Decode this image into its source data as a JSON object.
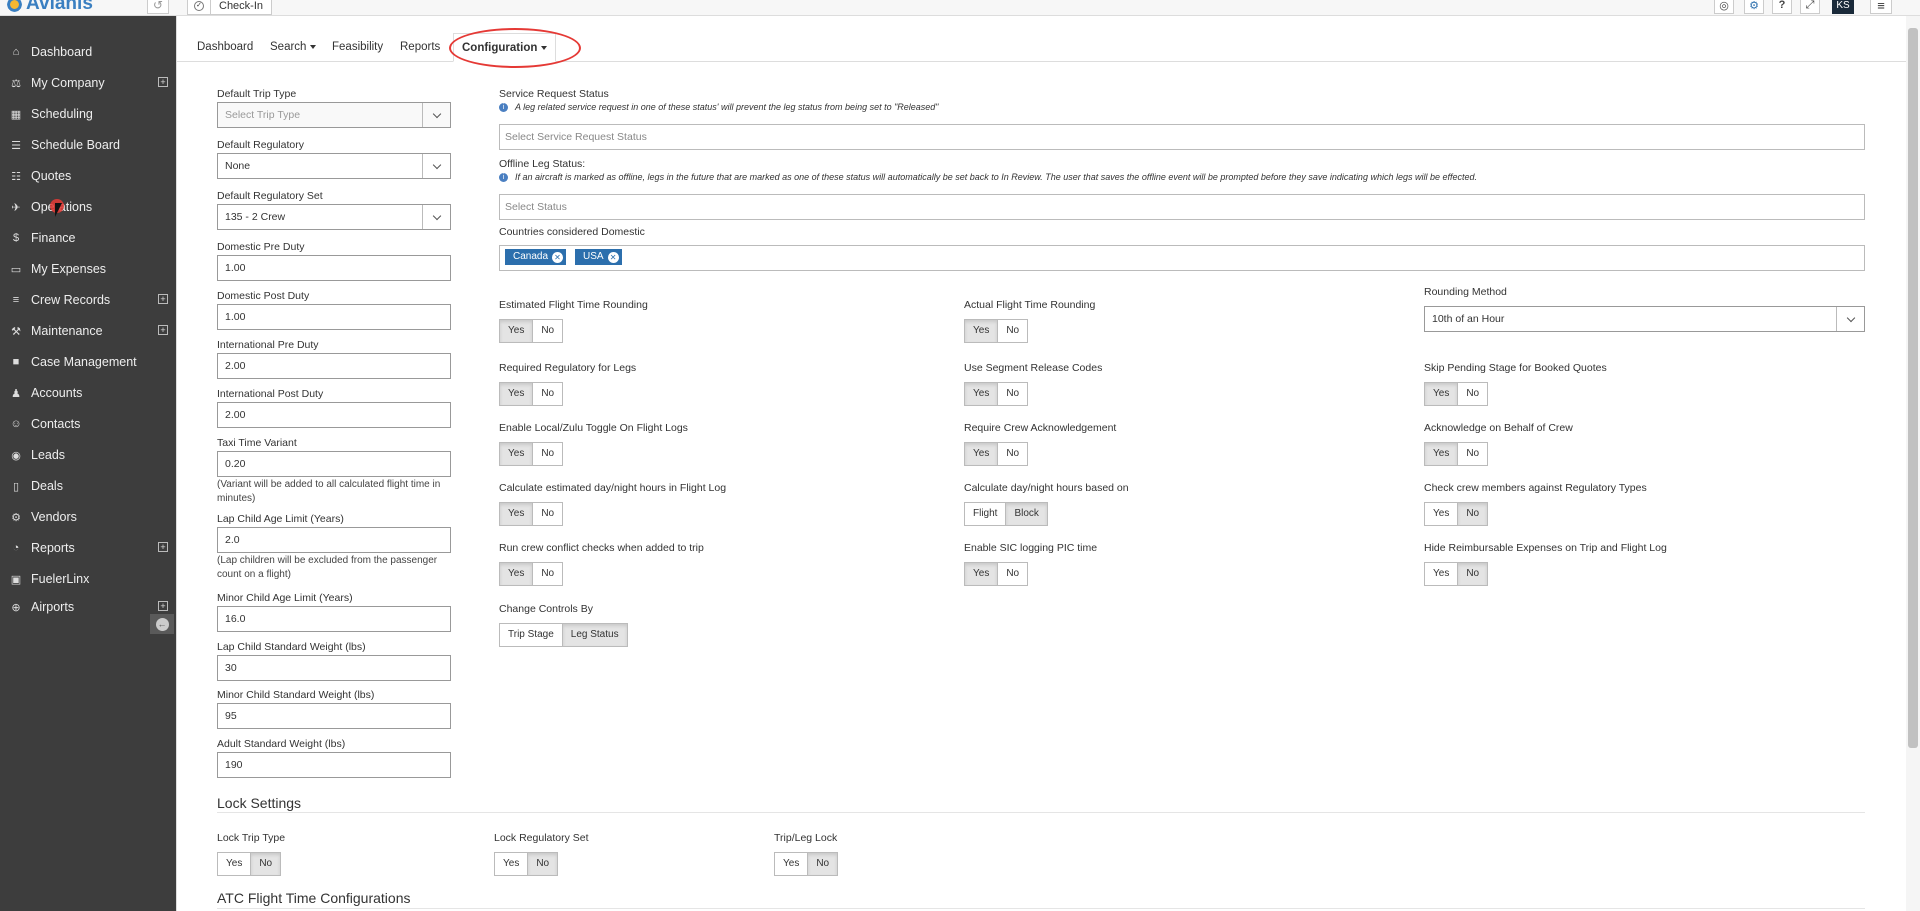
{
  "topbar": {
    "brand": "Avianis",
    "checkin_label": "Check-In",
    "user_initials": "KS",
    "icons": [
      "history-icon",
      "compass-icon",
      "globe-icon",
      "help-icon",
      "expand-icon",
      "avatar",
      "hamburger-menu-icon"
    ]
  },
  "sidebar": {
    "items": [
      {
        "label": "Dashboard",
        "icon": "home-icon",
        "expandable": false
      },
      {
        "label": "My Company",
        "icon": "bank-icon",
        "expandable": true
      },
      {
        "label": "Scheduling",
        "icon": "calendar-icon",
        "expandable": false
      },
      {
        "label": "Schedule Board",
        "icon": "board-icon",
        "expandable": false
      },
      {
        "label": "Quotes",
        "icon": "document-icon",
        "expandable": false
      },
      {
        "label": "Operations",
        "icon": "plane-icon",
        "expandable": false
      },
      {
        "label": "Finance",
        "icon": "dollar-icon",
        "expandable": false
      },
      {
        "label": "My Expenses",
        "icon": "card-icon",
        "expandable": false
      },
      {
        "label": "Crew Records",
        "icon": "list-icon",
        "expandable": true
      },
      {
        "label": "Maintenance",
        "icon": "wrench-icon",
        "expandable": true
      },
      {
        "label": "Case Management",
        "icon": "folder-icon",
        "expandable": false
      },
      {
        "label": "Accounts",
        "icon": "users-icon",
        "expandable": false
      },
      {
        "label": "Contacts",
        "icon": "user-icon",
        "expandable": false
      },
      {
        "label": "Leads",
        "icon": "lead-icon",
        "expandable": false
      },
      {
        "label": "Deals",
        "icon": "bookmark-icon",
        "expandable": false
      },
      {
        "label": "Vendors",
        "icon": "cogs-icon",
        "expandable": false
      },
      {
        "label": "Reports",
        "icon": "pie-chart-icon",
        "expandable": true
      },
      {
        "label": "FuelerLinx",
        "icon": "fuelerlinx-icon",
        "expandable": false
      },
      {
        "label": "Airports",
        "icon": "crosshair-icon",
        "expandable": true
      }
    ]
  },
  "tabs": [
    {
      "label": "Dashboard",
      "active": false,
      "dropdown": false
    },
    {
      "label": "Search",
      "active": false,
      "dropdown": true
    },
    {
      "label": "Feasibility",
      "active": false,
      "dropdown": false
    },
    {
      "label": "Reports",
      "active": false,
      "dropdown": false
    },
    {
      "label": "Configuration",
      "active": true,
      "dropdown": true
    }
  ],
  "left": {
    "default_trip_type": {
      "label": "Default Trip Type",
      "placeholder": "Select Trip Type"
    },
    "default_regulatory": {
      "label": "Default Regulatory",
      "value": "None"
    },
    "default_regulatory_set": {
      "label": "Default Regulatory Set",
      "value": "135 - 2 Crew"
    },
    "domestic_pre_duty": {
      "label": "Domestic Pre Duty",
      "value": "1.00"
    },
    "domestic_post_duty": {
      "label": "Domestic Post Duty",
      "value": "1.00"
    },
    "intl_pre_duty": {
      "label": "International Pre Duty",
      "value": "2.00"
    },
    "intl_post_duty": {
      "label": "International Post Duty",
      "value": "2.00"
    },
    "taxi_time_variant": {
      "label": "Taxi Time Variant",
      "value": "0.20",
      "note": "(Variant will be added to all calculated flight time in minutes)"
    },
    "lap_child_age": {
      "label": "Lap Child Age Limit (Years)",
      "value": "2.0",
      "note": "(Lap children will be excluded from the passenger count on a flight)"
    },
    "minor_child_age": {
      "label": "Minor Child Age Limit (Years)",
      "value": "16.0"
    },
    "lap_child_weight": {
      "label": "Lap Child Standard Weight (lbs)",
      "value": "30"
    },
    "minor_child_weight": {
      "label": "Minor Child Standard Weight (lbs)",
      "value": "95"
    },
    "adult_weight": {
      "label": "Adult Standard Weight (lbs)",
      "value": "190"
    }
  },
  "right": {
    "service_request_status": {
      "label": "Service Request Status",
      "info": "A leg related service request in one of these status' will prevent the leg status from being set to \"Released\"",
      "placeholder": "Select Service Request Status"
    },
    "offline_leg_status": {
      "label": "Offline Leg Status:",
      "info": "If an aircraft is marked as offline, legs in the future that are marked as one of these status will automatically be set back to In Review. The user that saves the offline event will be prompted before they save indicating which legs will be effected.",
      "placeholder": "Select Status"
    },
    "domestic_countries": {
      "label": "Countries considered Domestic",
      "chips": [
        "Canada",
        "USA"
      ]
    },
    "rounding_method": {
      "label": "Rounding Method",
      "value": "10th of an Hour"
    }
  },
  "toggles": [
    {
      "label": "Estimated Flight Time Rounding",
      "options": [
        "Yes",
        "No"
      ],
      "selected": "Yes"
    },
    {
      "label": "Actual Flight Time Rounding",
      "options": [
        "Yes",
        "No"
      ],
      "selected": "Yes"
    },
    {
      "label": "Required Regulatory for Legs",
      "options": [
        "Yes",
        "No"
      ],
      "selected": "Yes"
    },
    {
      "label": "Use Segment Release Codes",
      "options": [
        "Yes",
        "No"
      ],
      "selected": "Yes"
    },
    {
      "label": "Skip Pending Stage for Booked Quotes",
      "options": [
        "Yes",
        "No"
      ],
      "selected": "Yes"
    },
    {
      "label": "Enable Local/Zulu Toggle On Flight Logs",
      "options": [
        "Yes",
        "No"
      ],
      "selected": "Yes"
    },
    {
      "label": "Require Crew Acknowledgement",
      "options": [
        "Yes",
        "No"
      ],
      "selected": "Yes"
    },
    {
      "label": "Acknowledge on Behalf of Crew",
      "options": [
        "Yes",
        "No"
      ],
      "selected": "Yes"
    },
    {
      "label": "Calculate estimated day/night hours in Flight Log",
      "options": [
        "Yes",
        "No"
      ],
      "selected": "Yes"
    },
    {
      "label": "Calculate day/night hours based on",
      "options": [
        "Flight",
        "Block"
      ],
      "selected": "Block"
    },
    {
      "label": "Check crew members against Regulatory Types",
      "options": [
        "Yes",
        "No"
      ],
      "selected": "No"
    },
    {
      "label": "Run crew conflict checks when added to trip",
      "options": [
        "Yes",
        "No"
      ],
      "selected": "Yes"
    },
    {
      "label": "Enable SIC logging PIC time",
      "options": [
        "Yes",
        "No"
      ],
      "selected": "Yes"
    },
    {
      "label": "Hide Reimbursable Expenses on Trip and Flight Log",
      "options": [
        "Yes",
        "No"
      ],
      "selected": "No"
    },
    {
      "label": "Change Controls By",
      "options": [
        "Trip Stage",
        "Leg Status"
      ],
      "selected": "Leg Status"
    }
  ],
  "lock_settings": {
    "title": "Lock Settings",
    "items": [
      {
        "label": "Lock Trip Type",
        "options": [
          "Yes",
          "No"
        ],
        "selected": "No"
      },
      {
        "label": "Lock Regulatory Set",
        "options": [
          "Yes",
          "No"
        ],
        "selected": "No"
      },
      {
        "label": "Trip/Leg Lock",
        "options": [
          "Yes",
          "No"
        ],
        "selected": "No"
      }
    ]
  },
  "atc_title": "ATC Flight Time Configurations"
}
